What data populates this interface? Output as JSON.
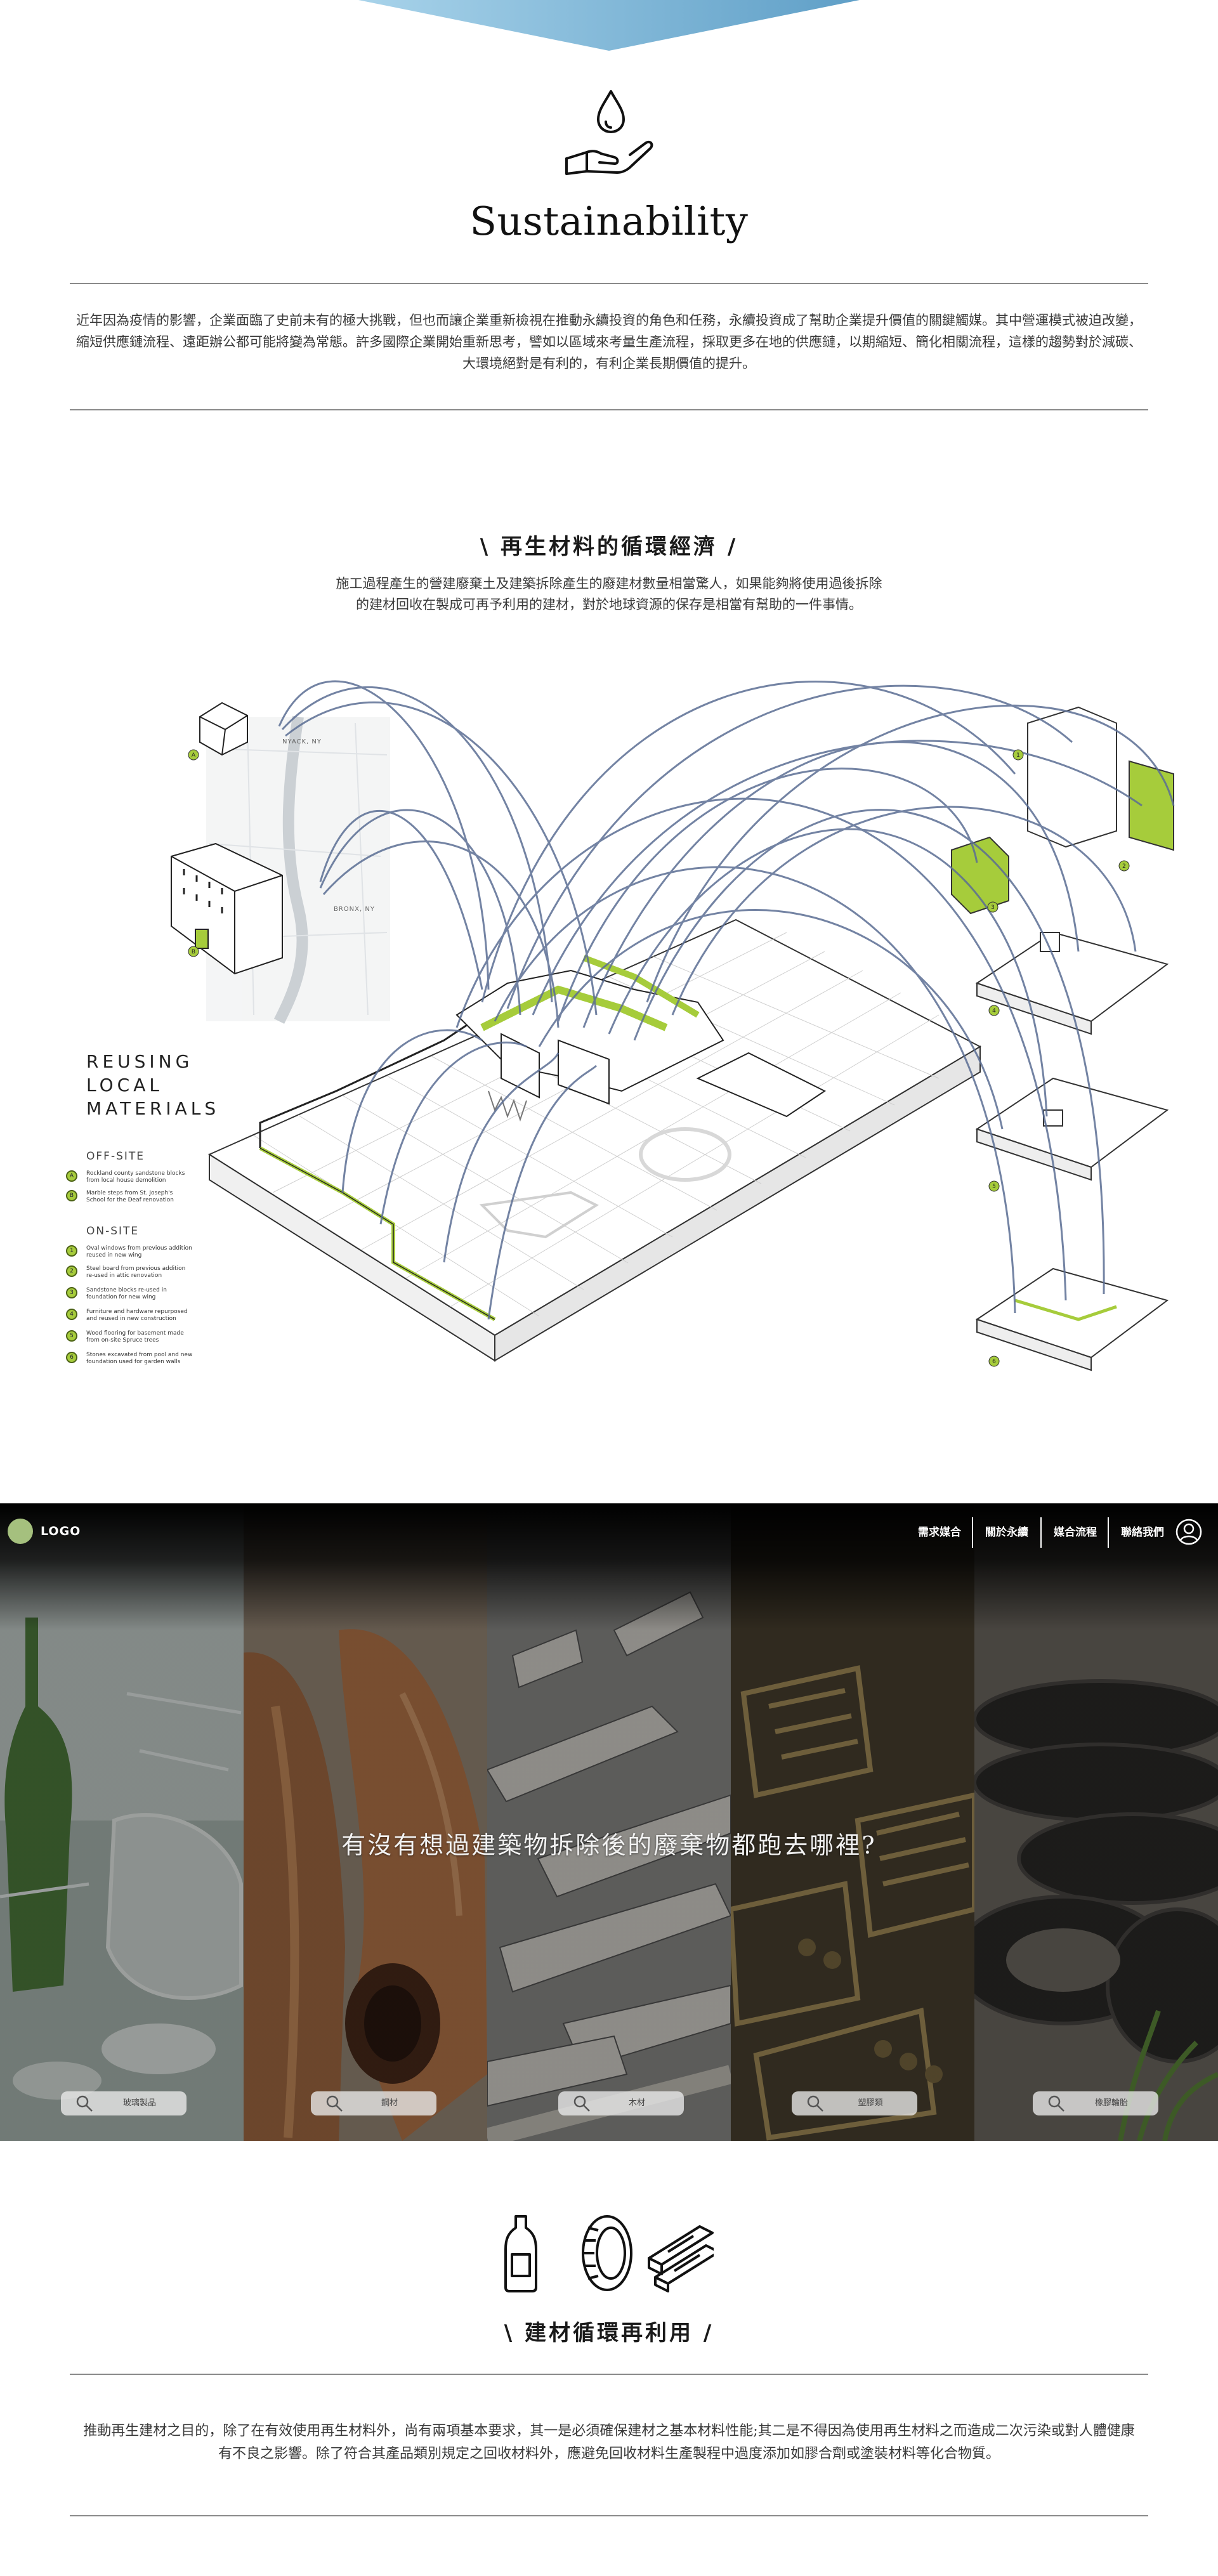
{
  "header": {
    "title": "Sustainability",
    "intro": "近年因為疫情的影響，企業面臨了史前未有的極大挑戰，但也而讓企業重新檢視在推動永續投資的角色和任務，永續投資成了幫助企業提升價值的關鍵觸媒。其中營運模式被迫改變，縮短供應鏈流程、遠距辦公都可能將變為常態。許多國際企業開始重新思考，譬如以區域來考量生產流程，採取更多在地的供應鏈，以期縮短、簡化相關流程，這樣的趨勢對於減碳、大環境絕對是有利的，有利企業長期價值的提升。"
  },
  "circular": {
    "title": "\\ 再生材料的循環經濟 /",
    "desc_line1": "施工過程產生的營建廢棄土及建築拆除產生的廢建材數量相當驚人，如果能夠將使用過後拆除",
    "desc_line2": "的建材回收在製成可再予利用的建材，對於地球資源的保存是相當有幫助的一件事情。"
  },
  "diagram": {
    "title_lines": [
      "REUSING",
      "LOCAL",
      "MATERIALS"
    ],
    "offsite_label": "OFF-SITE",
    "onsite_label": "ON-SITE",
    "map_labels": [
      "NYACK, NY",
      "BRONX, NY"
    ],
    "offsite_items": [
      {
        "num": "A",
        "text": "Rockland county sandstone blocks from local house demolition"
      },
      {
        "num": "B",
        "text": "Marble steps from St. Joseph's School for the Deaf renovation"
      }
    ],
    "onsite_items": [
      {
        "num": "1",
        "text": "Oval windows from previous addition reused in new wing"
      },
      {
        "num": "2",
        "text": "Steel board from previous addition re-used in attic renovation"
      },
      {
        "num": "3",
        "text": "Sandstone blocks re-used in foundation for new wing"
      },
      {
        "num": "4",
        "text": "Furniture and hardware repurposed and reused in new construction"
      },
      {
        "num": "5",
        "text": "Wood flooring for basement made from on-site Spruce trees"
      },
      {
        "num": "6",
        "text": "Stones excavated from pool and new foundation used for garden walls"
      }
    ]
  },
  "navbar": {
    "logo": "LOGO",
    "items": [
      "需求媒合",
      "關於永續",
      "媒合流程",
      "聯絡我們"
    ]
  },
  "band": {
    "title": "有沒有想過建築物拆除後的廢棄物都跑去哪裡?",
    "chips": [
      "玻璃製品",
      "鋼材",
      "木材",
      "塑膠類",
      "橡膠輪胎"
    ]
  },
  "recycle": {
    "title": "\\ 建材循環再利用 /",
    "desc": "推動再生建材之目的，除了在有效使用再生材料外，尚有兩項基本要求，其一是必須確保建材之基本材料性能;其二是不得因為使用再生材料之而造成二次污染或對人體健康有不良之影響。除了符合其產品類別規定之回收材料外，應避免回收材料生產製程中過度添加如膠合劑或塗裝材料等化合物質。"
  },
  "colors": {
    "accent_green": "#a6cc3b",
    "banner_blue": "#7fb4d6",
    "arc_blue": "#5b6e94",
    "logo_green": "#a5c07e"
  }
}
